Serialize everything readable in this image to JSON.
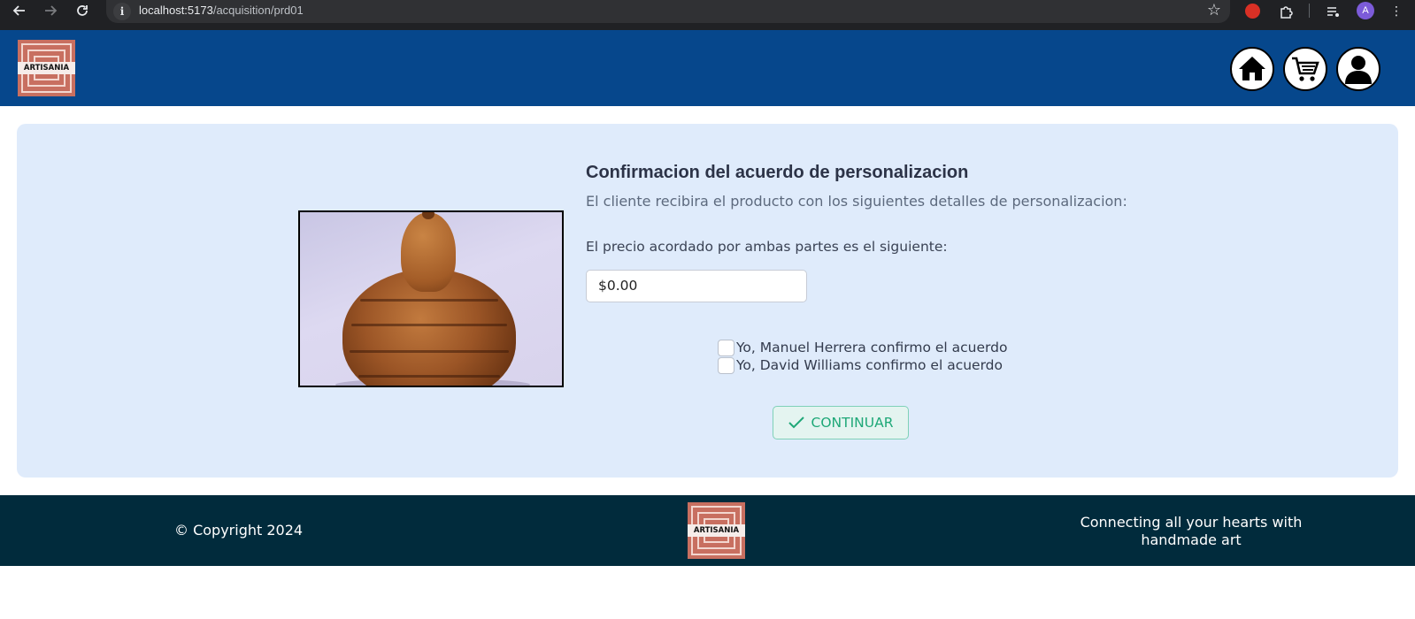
{
  "browser": {
    "url_host": "localhost:5173",
    "url_path": "/acquisition/prd01",
    "profile_initial": "A",
    "icons": [
      "back-arrow-icon",
      "forward-arrow-icon",
      "reload-icon",
      "site-info-icon",
      "bookmark-star-icon",
      "extension-red-icon",
      "puzzle-extension-icon",
      "media-queue-icon",
      "kebab-menu-icon"
    ]
  },
  "header": {
    "logo_text": "ARTISANIA",
    "nav_icons": [
      "home-icon",
      "cart-icon",
      "user-icon"
    ],
    "brand_color": "#06478c"
  },
  "main": {
    "title": "Confirmacion del acuerdo de personalizacion",
    "subtitle": "El cliente recibira el producto con los siguientes detalles de personalizacion:",
    "price_label": "El precio acordado por ambas partes es el siguiente:",
    "price_value": "$0.00",
    "confirmations": [
      {
        "label": "Yo, Manuel Herrera confirmo el acuerdo",
        "checked": false
      },
      {
        "label": "Yo, David Williams confirmo el acuerdo",
        "checked": false
      }
    ],
    "continue_label": "CONTINUAR",
    "card_color": "#dfebfb",
    "accent_color": "#1fa878"
  },
  "footer": {
    "copyright": "© Copyright 2024",
    "logo_text": "ARTISANIA",
    "tagline": "Connecting all your hearts with handmade art",
    "background_color": "#012b3c"
  }
}
